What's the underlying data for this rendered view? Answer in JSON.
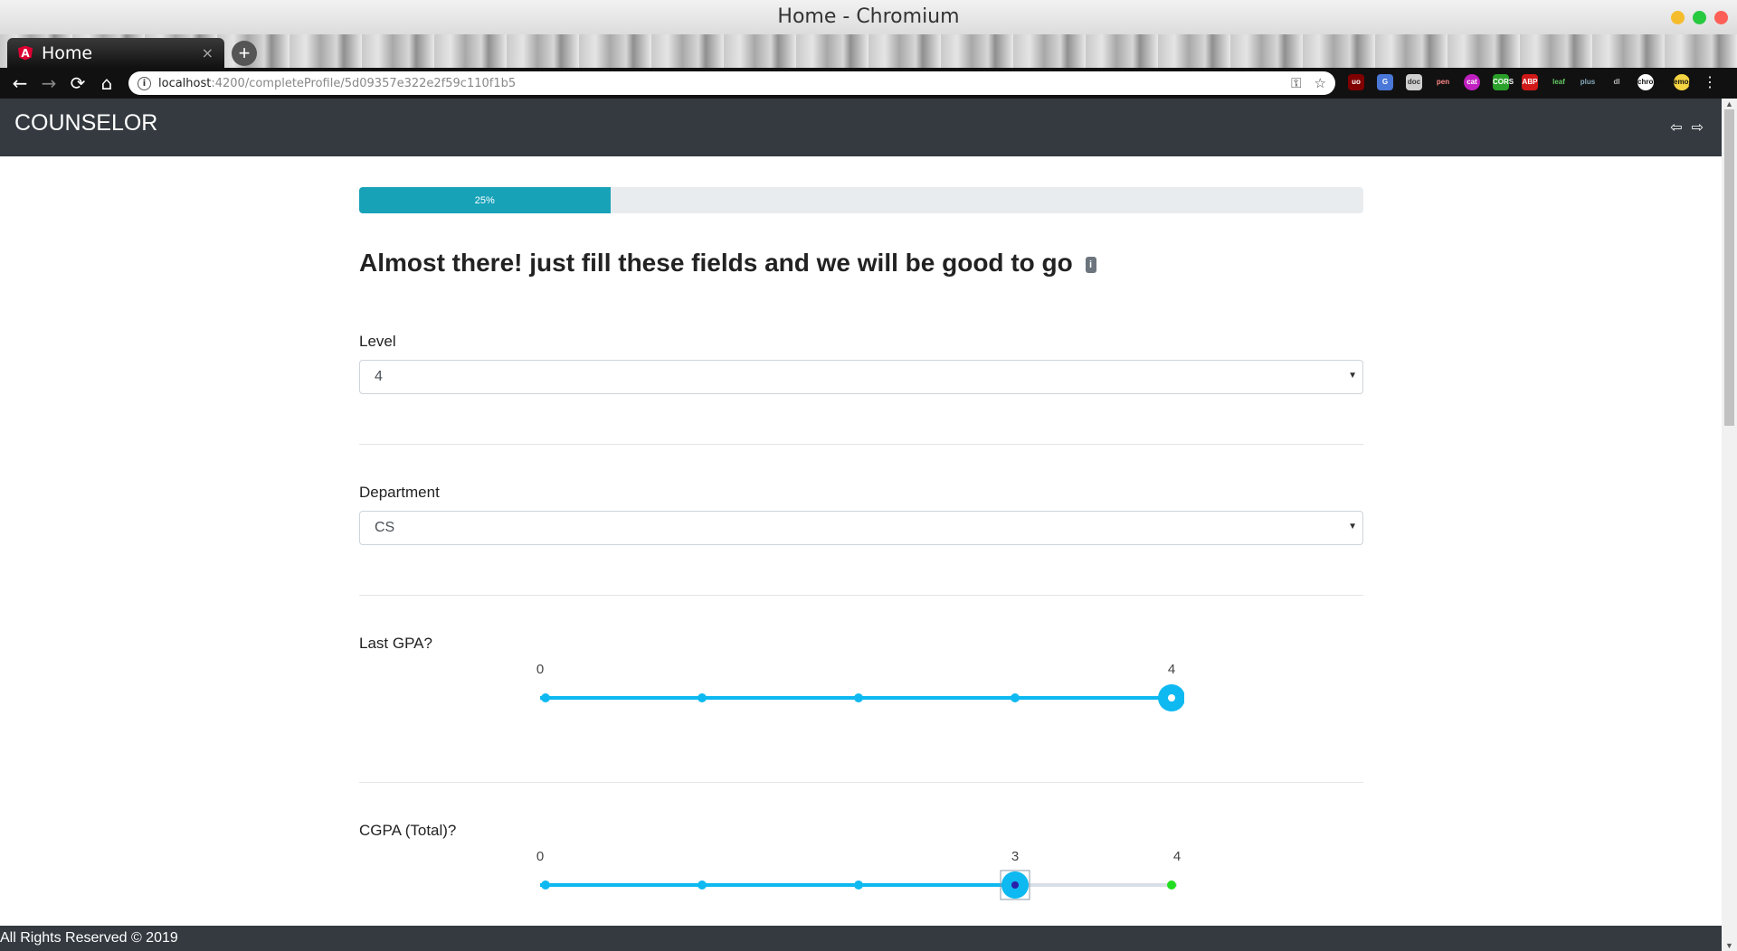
{
  "window": {
    "title": "Home - Chromium"
  },
  "browser": {
    "tab_title": "Home",
    "url_host": "localhost",
    "url_path": ":4200/completeProfile/5d09357e322e2f59c110f1b5",
    "back": "←",
    "forward": "→",
    "reload": "⟳",
    "home": "⌂",
    "key_icon": "⚿",
    "star_icon": "☆",
    "new_tab": "+",
    "close_tab": "×",
    "menu": "⋮",
    "extensions": [
      "uo",
      "G",
      "doc",
      "pen",
      "cat",
      "CORS",
      "ABP",
      "leaf",
      "plus",
      "dl",
      "chrome",
      "emoji"
    ]
  },
  "navbar": {
    "brand": "COUNSELOR",
    "logout_icon": "sign-out-icon",
    "login_icon": "sign-in-icon",
    "logout_glyph": "⇦",
    "login_glyph": "⇨"
  },
  "progress": {
    "label": "25%",
    "value": 0.25
  },
  "form": {
    "heading": "Almost there! just fill these fields and we will be good to go",
    "info_badge": "i",
    "level": {
      "label": "Level",
      "value": "4"
    },
    "department": {
      "label": "Department",
      "value": "CS"
    },
    "last_gpa": {
      "label": "Last GPA?",
      "min": 0,
      "max": 4,
      "value": 4,
      "min_label": "0",
      "max_label": "4",
      "value_label": "4"
    },
    "cgpa": {
      "label": "CGPA (Total)?",
      "min": 0,
      "max": 4,
      "value": 3,
      "min_label": "0",
      "max_label": "4",
      "value_label": "3"
    }
  },
  "colors": {
    "navbar_bg": "#343a40",
    "progress_fill": "#17a2b8",
    "slider_accent": "#0db9f0",
    "slider_track": "#d8dfe6",
    "slider_end_dot": "#22dd22"
  },
  "footer": {
    "text": "All Rights Reserved © 2019"
  }
}
